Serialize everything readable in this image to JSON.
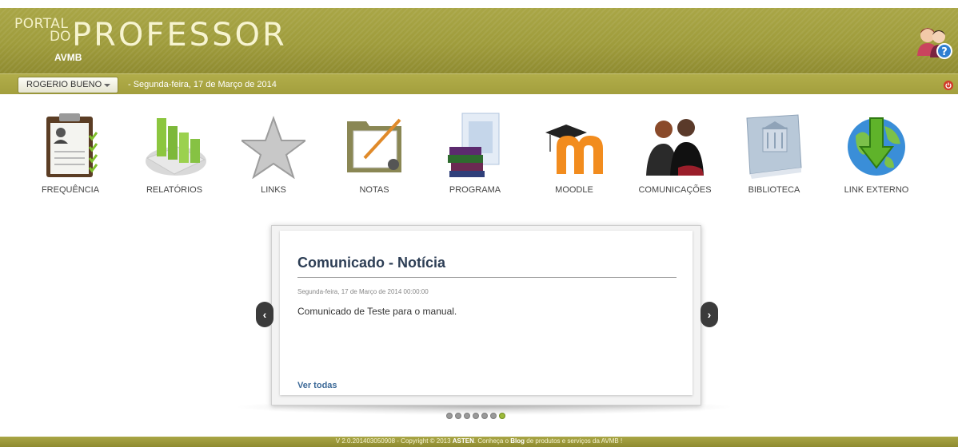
{
  "header": {
    "logo_portal": "PORTAL",
    "logo_do": "DO",
    "logo_professor": "PROFESSOR",
    "logo_org": "AVMB",
    "help_icon": "users-help-icon"
  },
  "info_bar": {
    "user_name": "ROGERIO BUENO",
    "date_text": "-   Segunda-feira, 17 de Março de 2014",
    "power_icon": "power-icon"
  },
  "menu": [
    {
      "label": "FREQUÊNCIA",
      "icon": "clipboard-icon"
    },
    {
      "label": "RELATÓRIOS",
      "icon": "bar-chart-icon"
    },
    {
      "label": "LINKS",
      "icon": "star-icon"
    },
    {
      "label": "NOTAS",
      "icon": "folder-pencil-icon"
    },
    {
      "label": "PROGRAMA",
      "icon": "books-icon"
    },
    {
      "label": "MOODLE",
      "icon": "moodle-icon"
    },
    {
      "label": "COMUNICAÇÕES",
      "icon": "people-icon"
    },
    {
      "label": "BIBLIOTECA",
      "icon": "library-book-icon"
    },
    {
      "label": "LINK EXTERNO",
      "icon": "globe-arrow-icon"
    }
  ],
  "news": {
    "title": "Comunicado - Notícia",
    "date": "Segunda-feira, 17 de Março de 2014 00:00:00",
    "body": "Comunicado de Teste para o manual.",
    "link": "Ver todas",
    "prev_label": "‹",
    "next_label": "›",
    "dot_count": 7,
    "active_dot": 7
  },
  "footer": {
    "version": "V 2.0.201403050908 - Copyright © 2013 ",
    "company": "ASTEN",
    "mid": ". Conheça o ",
    "blog": "Blog",
    "tail": " de produtos e serviços da AVMB !"
  },
  "colors": {
    "header_olive": "#a39f3d",
    "title_navy": "#2d3e55",
    "link_blue": "#3d6a98",
    "dot_active": "#9dbb3a"
  }
}
